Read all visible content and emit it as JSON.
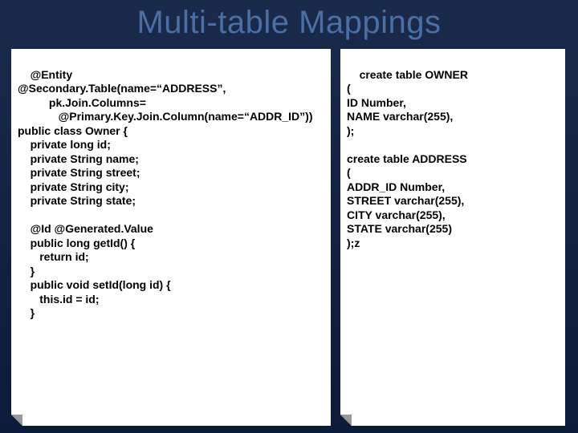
{
  "title": "Multi-table Mappings",
  "leftPanel": "@Entity\n@Secondary.Table(name=“ADDRESS”,\n          pk.Join.Columns=\n             @Primary.Key.Join.Column(name=“ADDR_ID”))\npublic class Owner {\n    private long id;\n    private String name;\n    private String street;\n    private String city;\n    private String state;\n\n    @Id @Generated.Value\n    public long getId() {\n       return id;\n    }\n    public void setId(long id) {\n       this.id = id;\n    }",
  "rightPanel": "create table OWNER\n(\nID Number,\nNAME varchar(255),\n);\n\ncreate table ADDRESS\n(\nADDR_ID Number,\nSTREET varchar(255),\nCITY varchar(255),\nSTATE varchar(255)\n);z"
}
